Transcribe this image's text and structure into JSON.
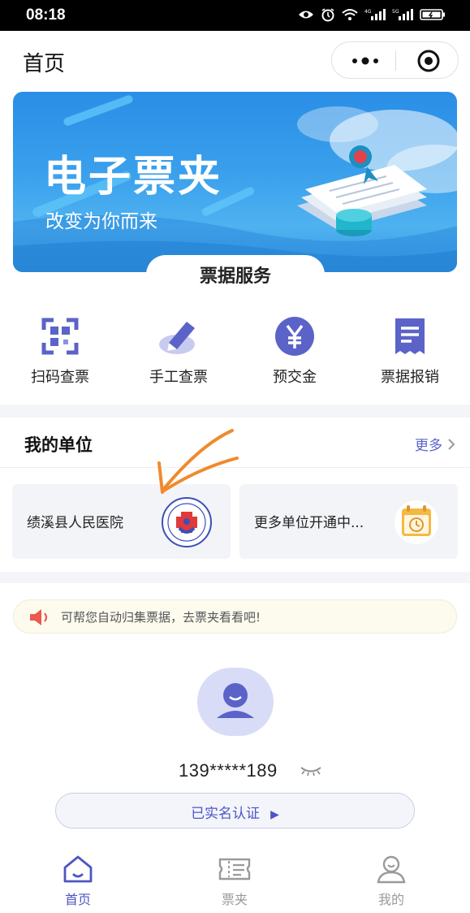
{
  "status_bar": {
    "time": "08:18",
    "icons": [
      "eye-icon",
      "alarm-icon",
      "wifi-icon",
      "signal-4g-icon",
      "signal-5g-icon",
      "battery-icon"
    ]
  },
  "header": {
    "title": "首页",
    "more_icon": "more-dots-icon",
    "close_icon": "target-close-icon"
  },
  "banner": {
    "title": "电子票夹",
    "subtitle": "改变为你而来"
  },
  "services": {
    "heading": "票据服务",
    "items": [
      {
        "label": "扫码查票",
        "icon": "scan-icon"
      },
      {
        "label": "手工查票",
        "icon": "pen-icon"
      },
      {
        "label": "预交金",
        "icon": "yen-icon"
      },
      {
        "label": "票据报销",
        "icon": "receipt-icon"
      }
    ]
  },
  "my_units": {
    "title": "我的单位",
    "more": "更多",
    "cards": [
      {
        "name": "绩溪县人民医院",
        "logo": "hospital-logo"
      },
      {
        "name": "更多单位开通中...",
        "logo": "calendar-icon"
      }
    ]
  },
  "notice": {
    "text": "可帮您自动归集票据，去票夹看看吧!",
    "icon": "speaker-icon"
  },
  "profile": {
    "phone": "139*****189",
    "verify_label": "已实名认证",
    "verify_arrow": "▶"
  },
  "tabbar": {
    "items": [
      {
        "label": "首页",
        "icon": "home-icon",
        "active": true
      },
      {
        "label": "票夹",
        "icon": "ticket-icon",
        "active": false
      },
      {
        "label": "我的",
        "icon": "user-icon",
        "active": false
      }
    ]
  },
  "colors": {
    "accent": "#4d56c4",
    "banner": "#3aa0ec",
    "annotation": "#f08a2c"
  }
}
